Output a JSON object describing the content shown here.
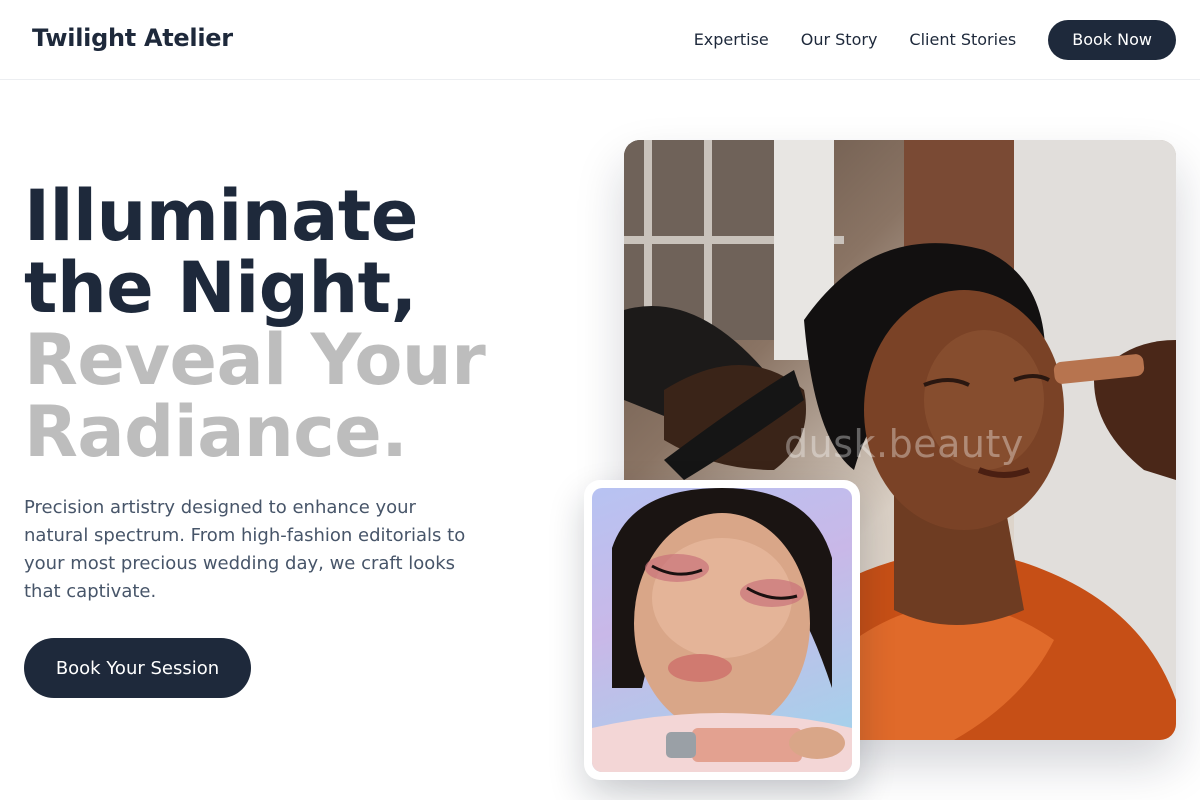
{
  "header": {
    "logo": "Twilight Atelier",
    "nav": [
      "Expertise",
      "Our Story",
      "Client Stories"
    ],
    "cta": "Book Now"
  },
  "hero": {
    "title_lines": [
      "Illuminate",
      "the Night,",
      "Reveal Your",
      "Radiance."
    ],
    "description": "Precision artistry designed to enhance your natural spectrum. From high-fashion editorials to your most precious wedding day, we craft looks that captivate.",
    "cta": "Book Your Session"
  },
  "images": {
    "main_watermark": "dusk.beauty",
    "main_photo": "makeup-artist-applying-bronzer-photo",
    "secondary_photo": "model-holding-blush-bottle-photo"
  },
  "colors": {
    "primary": "#1e293b",
    "accent_grey": "#bdbdbd",
    "body_text": "#475569"
  }
}
